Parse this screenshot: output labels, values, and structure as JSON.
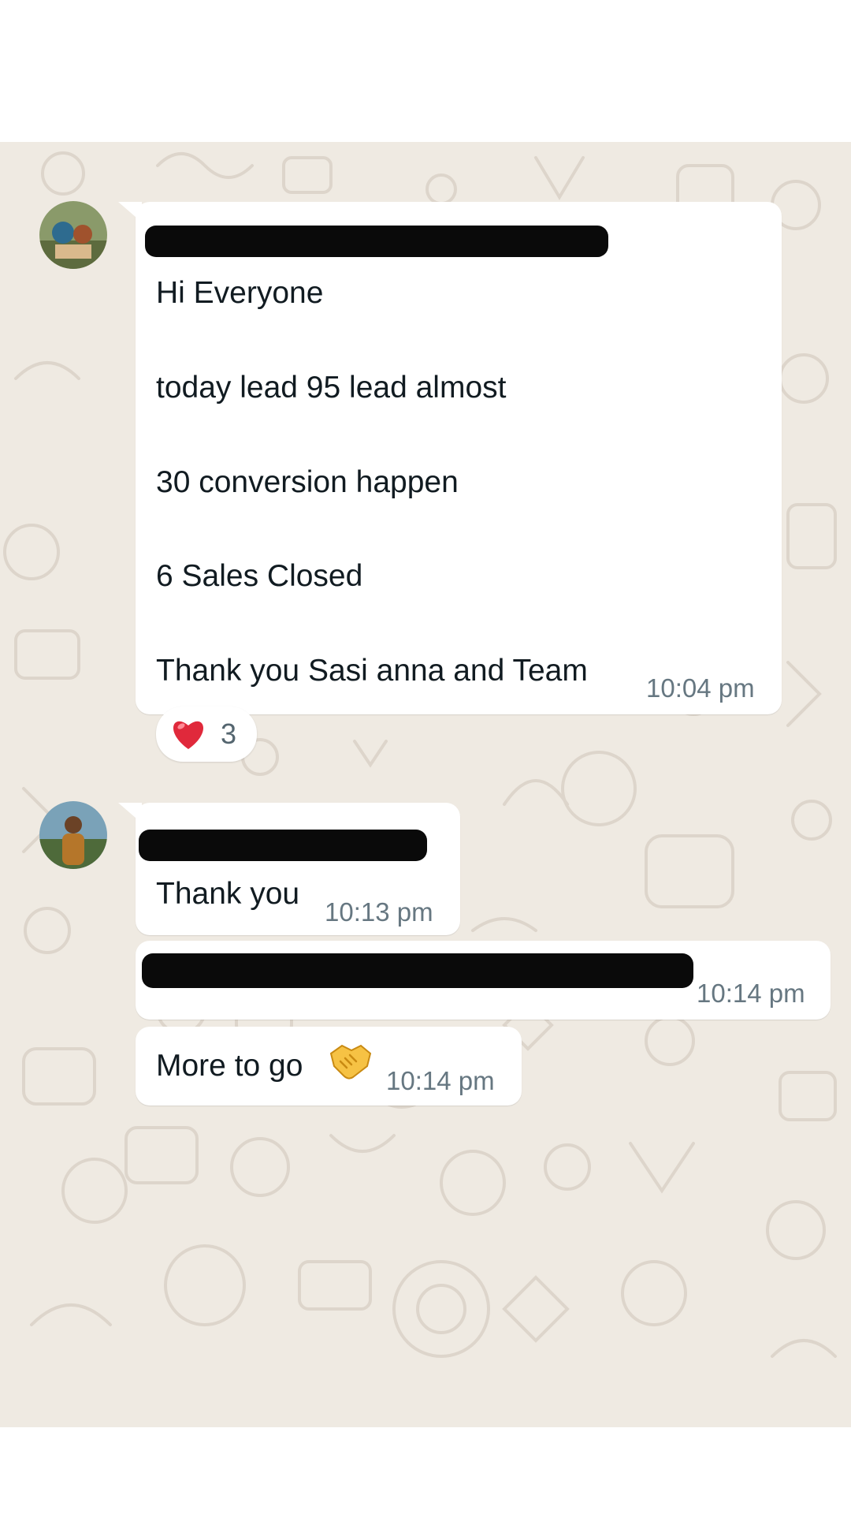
{
  "colors": {
    "chat_background": "#efeae2",
    "bubble": "#ffffff",
    "text": "#111b21",
    "timestamp": "#667781"
  },
  "messages": [
    {
      "sender": "redacted",
      "lines": [
        "Hi Everyone",
        "today lead 95 lead almost",
        "30 conversion happen",
        "6 Sales Closed",
        "Thank you Sasi anna and Team"
      ],
      "time": "10:04 pm",
      "reaction": {
        "icon": "heart-icon",
        "count": "3"
      }
    },
    {
      "sender": "redacted",
      "text": "Thank you",
      "time": "10:13 pm"
    },
    {
      "text": "redacted",
      "time": "10:14 pm"
    },
    {
      "text": "More to go",
      "emoji_icon": "handshake-icon",
      "time": "10:14 pm"
    }
  ]
}
